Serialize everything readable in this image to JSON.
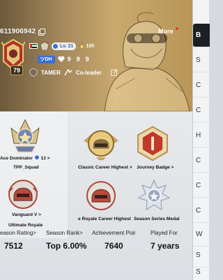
{
  "header": {
    "player_id": "611906942",
    "more_label": "More",
    "avatar_level": "79",
    "level": "Lv. 21",
    "hundred_badge": "100",
    "tag": "ツDH",
    "stat1": "9",
    "stat2": "9",
    "stat3": "9",
    "clan": "TAMER",
    "role": "Co-leader"
  },
  "badges": {
    "ace": {
      "title": "Ace Dominator",
      "count": "13",
      "arrow": ">",
      "sub": "TPP_Squad"
    },
    "classic": {
      "title": "Classic Career Highest",
      "arrow": ">"
    },
    "journey": {
      "title": "Journey Badge",
      "arrow": ">"
    },
    "vanguard": {
      "title": "Vanguard V",
      "arrow": ">",
      "sub": "Ultimate Royale"
    },
    "royale": {
      "title": "e Royale Career Highest"
    },
    "series": {
      "title": "Season Series Medal"
    }
  },
  "stats": [
    {
      "label": "eason Rating>",
      "value": "7512"
    },
    {
      "label": "Season Rank>",
      "value": "Top 6.00%"
    },
    {
      "label": "Achievement Poir",
      "value": "7640"
    },
    {
      "label": "Played For",
      "value": "7 years"
    }
  ],
  "sidebar": {
    "items": [
      {
        "label": "B"
      },
      {
        "label": "S"
      },
      {
        "label": "C"
      },
      {
        "label": "C"
      },
      {
        "label": "H"
      },
      {
        "label": "C"
      },
      {
        "label": "C"
      },
      {
        "label": "C"
      },
      {
        "label": "W"
      },
      {
        "label": "S"
      },
      {
        "label": "S"
      }
    ]
  },
  "colors": {
    "header_gold": "#c9a96e",
    "header_dark": "#6d5a3c",
    "accent_blue": "#3b6ed6",
    "notif_red": "#e23a2c",
    "sidebar_active": "#1c1f24"
  }
}
